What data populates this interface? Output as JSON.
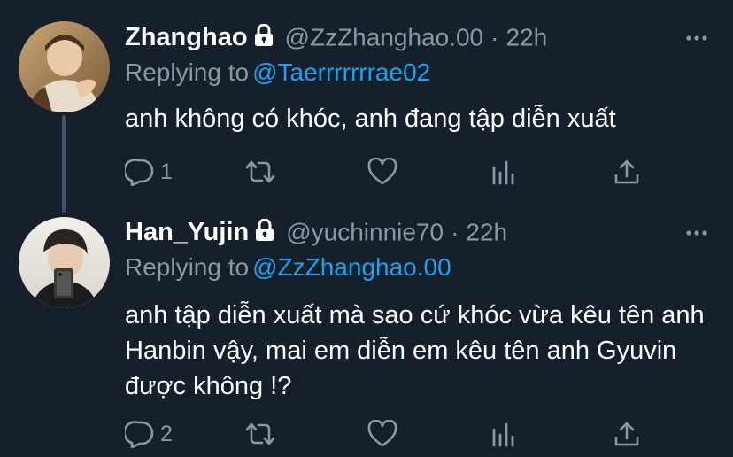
{
  "tweets": [
    {
      "display_name": "Zhanghao",
      "handle": "@ZzZhanghao.00",
      "separator": "·",
      "time": "22h",
      "replying_prefix": "Replying to",
      "replying_to": "@Taerrrrrrrae02",
      "text": "anh không có khóc, anh đang tập diễn xuất",
      "reply_count": "1",
      "retweet_count": "",
      "like_count": "",
      "protected": true,
      "icons": [
        "lock-icon",
        "more-icon",
        "reply-icon",
        "retweet-icon",
        "like-icon",
        "analytics-icon",
        "share-icon"
      ]
    },
    {
      "display_name": "Han_Yujin",
      "handle": "@yuchinnie70",
      "separator": "·",
      "time": "22h",
      "replying_prefix": "Replying to",
      "replying_to": "@ZzZhanghao.00",
      "text": "anh tập diễn xuất mà sao cứ khóc vừa kêu tên anh Hanbin vậy, mai em diễn em kêu tên anh Gyuvin được không !?",
      "reply_count": "2",
      "retweet_count": "",
      "like_count": "",
      "protected": true,
      "icons": [
        "lock-icon",
        "more-icon",
        "reply-icon",
        "retweet-icon",
        "like-icon",
        "analytics-icon",
        "share-icon"
      ]
    }
  ],
  "colors": {
    "background": "#15202b",
    "primary_text": "#ffffff",
    "secondary_text": "#8899a6",
    "link": "#1da1f2",
    "thread_line": "#3d5466"
  }
}
